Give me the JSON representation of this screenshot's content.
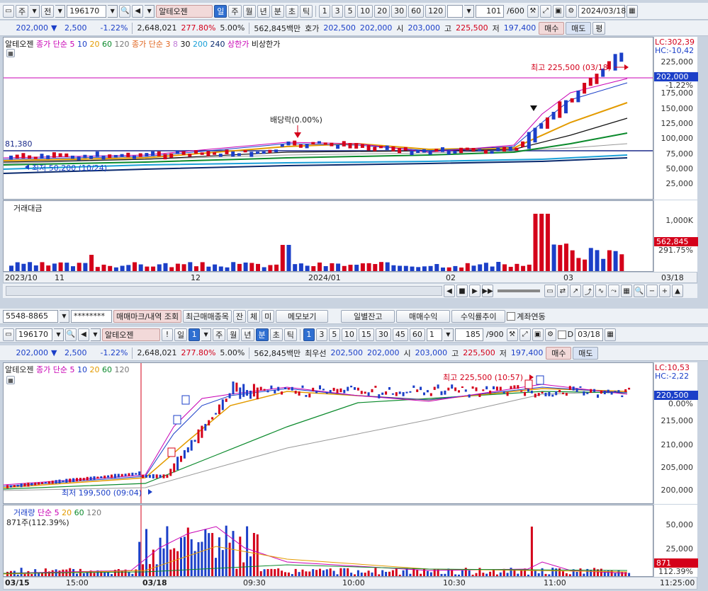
{
  "top": {
    "toolbar": {
      "market": "주",
      "type": "전",
      "code": "196170",
      "name": "알테오젠",
      "periods": [
        "일",
        "주",
        "월",
        "년",
        "분",
        "초",
        "틱"
      ],
      "period_active": "일",
      "minutes": [
        "1",
        "3",
        "5",
        "10",
        "20",
        "30",
        "60",
        "120"
      ],
      "count": "101",
      "count_total": "/600",
      "date": "2024/03/18"
    },
    "quote": {
      "price": "202,000",
      "change": "2,500",
      "pct": "-1.22%",
      "volume": "2,648,021",
      "vol_ratio": "277.80%",
      "float": "5.00%",
      "amount": "562,845백만",
      "bid_label": "호가",
      "bid": "202,500",
      "ask": "202,000",
      "open_label": "시",
      "open": "203,000",
      "high_label": "고",
      "high": "225,500",
      "low_label": "저",
      "low": "197,400",
      "buy": "매수",
      "sell": "매도",
      "rate": "평"
    },
    "legend": {
      "name": "알테오젠",
      "ma1": "종가 단순 5",
      "p10": "10",
      "p20": "20",
      "p60": "60",
      "p120": "120",
      "ma2": "종가 단순 3",
      "q8": "8",
      "q30": "30",
      "q200": "200",
      "q240": "240",
      "limit_up": "상한가",
      "limit_down": "비상한가"
    },
    "axis": {
      "lc": "LC:302,39",
      "hc": "HC:-10,42",
      "ticks": [
        "225,000",
        "200,000",
        "175,000",
        "150,000",
        "125,000",
        "100,000",
        "75,000",
        "50,000",
        "25,000"
      ],
      "price_tag": "202,000",
      "price_pct": "-1.22%",
      "vol_ticks": [
        "1,000K"
      ],
      "vol_tag": "562,845",
      "vol_pct": "291.75%"
    },
    "notes": {
      "high": "최고 225,500 (03/18)",
      "low": "최저 50,200 (10/24)",
      "line": "81,380",
      "dividend": "배당락(0.00%)"
    },
    "vol_title": "거래대금",
    "xaxis": [
      "2023/10",
      "11",
      "12",
      "2024/01",
      "02",
      "03",
      "03/18"
    ]
  },
  "bottom": {
    "account": {
      "number": "5548-8865",
      "password": "********",
      "btn_mark": "매매마크/내역 조회",
      "btn_recent": "최근매매종목",
      "btn_jan": "잔",
      "btn_che": "체",
      "btn_mi": "미",
      "btn_memo": "메모보기",
      "btn_balance": "일별잔고",
      "btn_profit": "매매수익",
      "btn_trend": "수익률추이",
      "link_label": "계좌연동"
    },
    "toolbar": {
      "code": "196170",
      "name": "알테오젠",
      "period": "일",
      "count1": "1",
      "periods": [
        "주",
        "월",
        "년",
        "분",
        "초",
        "틱"
      ],
      "period_active": "분",
      "minutes": [
        "1",
        "3",
        "5",
        "10",
        "15",
        "30",
        "45",
        "60"
      ],
      "min_active": "1",
      "sel": "1",
      "count": "185",
      "count_total": "/900",
      "d_label": "D",
      "date": "03/18"
    },
    "quote": {
      "price": "202,000",
      "change": "2,500",
      "pct": "-1.22%",
      "volume": "2,648,021",
      "vol_ratio": "277.80%",
      "float": "5.00%",
      "amount": "562,845백만",
      "bid_label": "최우선",
      "bid": "202,500",
      "ask": "202,000",
      "open_label": "시",
      "open": "203,000",
      "high_label": "고",
      "high": "225,500",
      "low_label": "저",
      "low": "197,400",
      "buy": "매수",
      "sell": "매도"
    },
    "legend": {
      "name": "알테오젠",
      "ma": "종가 단순 5",
      "p10": "10",
      "p20": "20",
      "p60": "60",
      "p120": "120"
    },
    "axis": {
      "lc": "LC:10,53",
      "hc": "HC:-2,22",
      "ticks": [
        "220,500",
        "215,000",
        "210,000",
        "205,000",
        "200,000"
      ],
      "price_tag": "220,500",
      "price_pct": "0.00%",
      "vol_ticks": [
        "50,000",
        "25,000"
      ],
      "vol_tag": "871",
      "vol_pct": "112.39%"
    },
    "notes": {
      "high": "최고 225,500 (10:57)",
      "low": "최저 199,500 (09:04)"
    },
    "vol_legend": {
      "title": "거래량",
      "ma": "단순 5",
      "p20": "20",
      "p60": "60",
      "p120": "120",
      "value": "871주(112.39%)"
    },
    "xaxis": [
      "03/15",
      "15:00",
      "03/18",
      "09:30",
      "10:00",
      "10:30",
      "11:00",
      "11:25:00"
    ]
  }
}
